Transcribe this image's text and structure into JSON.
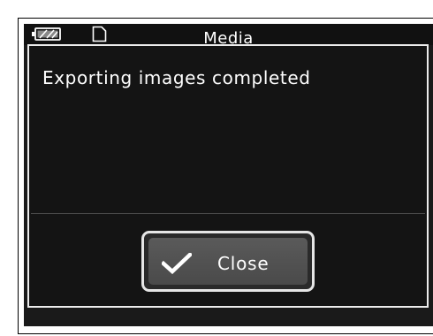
{
  "screen": {
    "title": "Media"
  },
  "status": {
    "battery_icon": "battery-icon",
    "card_icon": "memory-card-icon"
  },
  "dialog": {
    "message": "Exporting images completed",
    "close_label": "Close",
    "close_icon": "checkmark-icon"
  },
  "colors": {
    "background": "#1a1a1a",
    "dialog_border": "#ececec",
    "button_fill": "#555555",
    "text": "#ffffff"
  }
}
